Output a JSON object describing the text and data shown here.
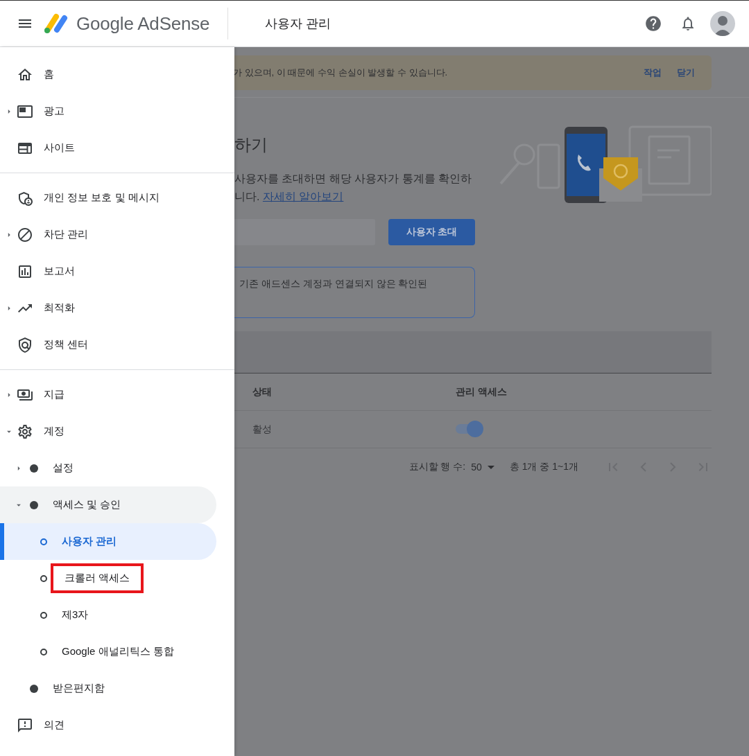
{
  "header": {
    "brand": "Google AdSense",
    "page_title": "사용자 관리"
  },
  "banner": {
    "message": "가 있으며, 이 때문에 수익 손실이 발생할 수 있습니다.",
    "actions": [
      "작업",
      "닫기"
    ]
  },
  "invite": {
    "heading": "하기",
    "description": "사용자를 초대하면 해당 사용자가 통계를 확인하",
    "description_2": "니다.",
    "link": "자세히 알아보기",
    "button": "사용자 초대",
    "notice": "기존 애드센스 계정과 연결되지 않은 확인된"
  },
  "table": {
    "columns": [
      "상태",
      "관리 액세스"
    ],
    "rows": [
      {
        "status": "활성",
        "admin_access": {
          "on": true
        }
      }
    ]
  },
  "pagination": {
    "rows_label": "표시할 행 수:",
    "rows_per_page": "50",
    "range": "총 1개 중 1~1개"
  },
  "sidebar": {
    "groups": [
      [
        {
          "label": "홈",
          "selected": false
        },
        {
          "label": "광고",
          "selected": false,
          "expanded": false
        },
        {
          "label": "사이트",
          "selected": false
        }
      ],
      [
        {
          "label": "개인 정보 보호 및 메시지",
          "selected": false
        },
        {
          "label": "차단 관리",
          "selected": false,
          "expanded": false
        },
        {
          "label": "보고서",
          "selected": false
        },
        {
          "label": "최적화",
          "selected": false,
          "expanded": false
        },
        {
          "label": "정책 센터",
          "selected": false
        }
      ],
      [
        {
          "label": "지급",
          "selected": false,
          "expanded": false
        },
        {
          "label": "계정",
          "selected": false,
          "expanded": true,
          "children": [
            {
              "label": "설정",
              "selected": false,
              "expanded": false
            },
            {
              "label": "액세스 및 승인",
              "selected": false,
              "expanded": true,
              "children": [
                {
                  "label": "사용자 관리",
                  "selected": true
                },
                {
                  "label": "크롤러 액세스",
                  "selected": false,
                  "annotated": true
                },
                {
                  "label": "제3자",
                  "selected": false
                },
                {
                  "label": "Google 애널리틱스 통합",
                  "selected": false
                }
              ]
            },
            {
              "label": "받은편지함",
              "selected": false
            }
          ]
        },
        {
          "label": "의견",
          "selected": false
        }
      ]
    ]
  }
}
